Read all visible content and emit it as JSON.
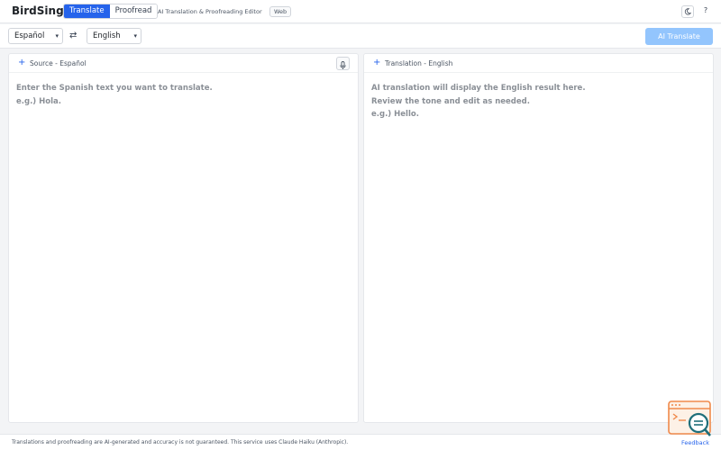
{
  "header": {
    "logo": "BirdSing",
    "tabs": [
      {
        "label": "Translate",
        "active": true
      },
      {
        "label": "Proofread",
        "active": false
      }
    ],
    "subtitle": "AI Translation & Proofreading Editor",
    "badge": "Web",
    "theme_icon": "moon-icon",
    "help_label": "?"
  },
  "toolbar": {
    "source_language": "Español",
    "target_language": "English",
    "swap_icon": "swap-arrows-icon",
    "translate_label": "AI Translate"
  },
  "source_panel": {
    "title": "Source - Español",
    "placeholder_lines": [
      "Enter the Spanish text you want to translate.",
      "e.g.) Hola."
    ]
  },
  "target_panel": {
    "title": "Translation - English",
    "placeholder_lines": [
      "AI translation will display the English result here.",
      "Review the tone and edit as needed.",
      "e.g.) Hello."
    ]
  },
  "footer": {
    "disclaimer": "Translations and proofreading are AI-generated and accuracy is not guaranteed. This service uses Claude Haiku (Anthropic).",
    "feedback_label": "Feedback"
  },
  "colors": {
    "accent": "#2563eb",
    "translate_button": "#93c5fd",
    "fab_orange": "#f08a4b",
    "fab_teal": "#1f6f7a"
  }
}
